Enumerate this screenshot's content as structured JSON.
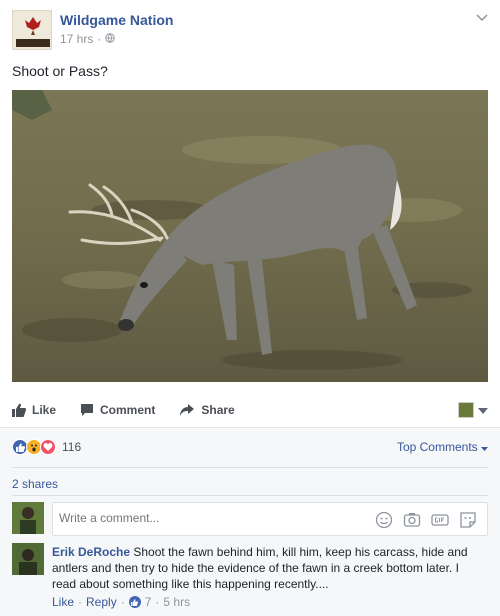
{
  "post": {
    "page_name": "Wildgame Nation",
    "logo_text": "NATION",
    "time": "17 hrs",
    "privacy_icon": "globe-icon",
    "text": "Shoot or Pass?"
  },
  "actions": {
    "like": "Like",
    "comment": "Comment",
    "share": "Share"
  },
  "reactions": {
    "count": "116",
    "types": [
      "like",
      "wow",
      "love"
    ],
    "colors": {
      "like": "#4267b2",
      "wow": "#f7b125",
      "love": "#f25268"
    }
  },
  "top_comments": "Top Comments",
  "shares": "2 shares",
  "composer": {
    "placeholder": "Write a comment...",
    "icons": [
      "emoji-icon",
      "camera-icon",
      "gif-icon",
      "sticker-icon"
    ]
  },
  "comment": {
    "author": "Erik DeRoche",
    "text": "Shoot the fawn behind him, kill him, keep his carcass, hide and antlers and then try to hide the evidence of the fawn in a creek bottom later. I read about something like this happening recently....",
    "like": "Like",
    "reply": "Reply",
    "likes": "7",
    "time": "5 hrs"
  },
  "colors": {
    "link": "#365899",
    "muted": "#90949c",
    "action": "#4b4f56"
  }
}
